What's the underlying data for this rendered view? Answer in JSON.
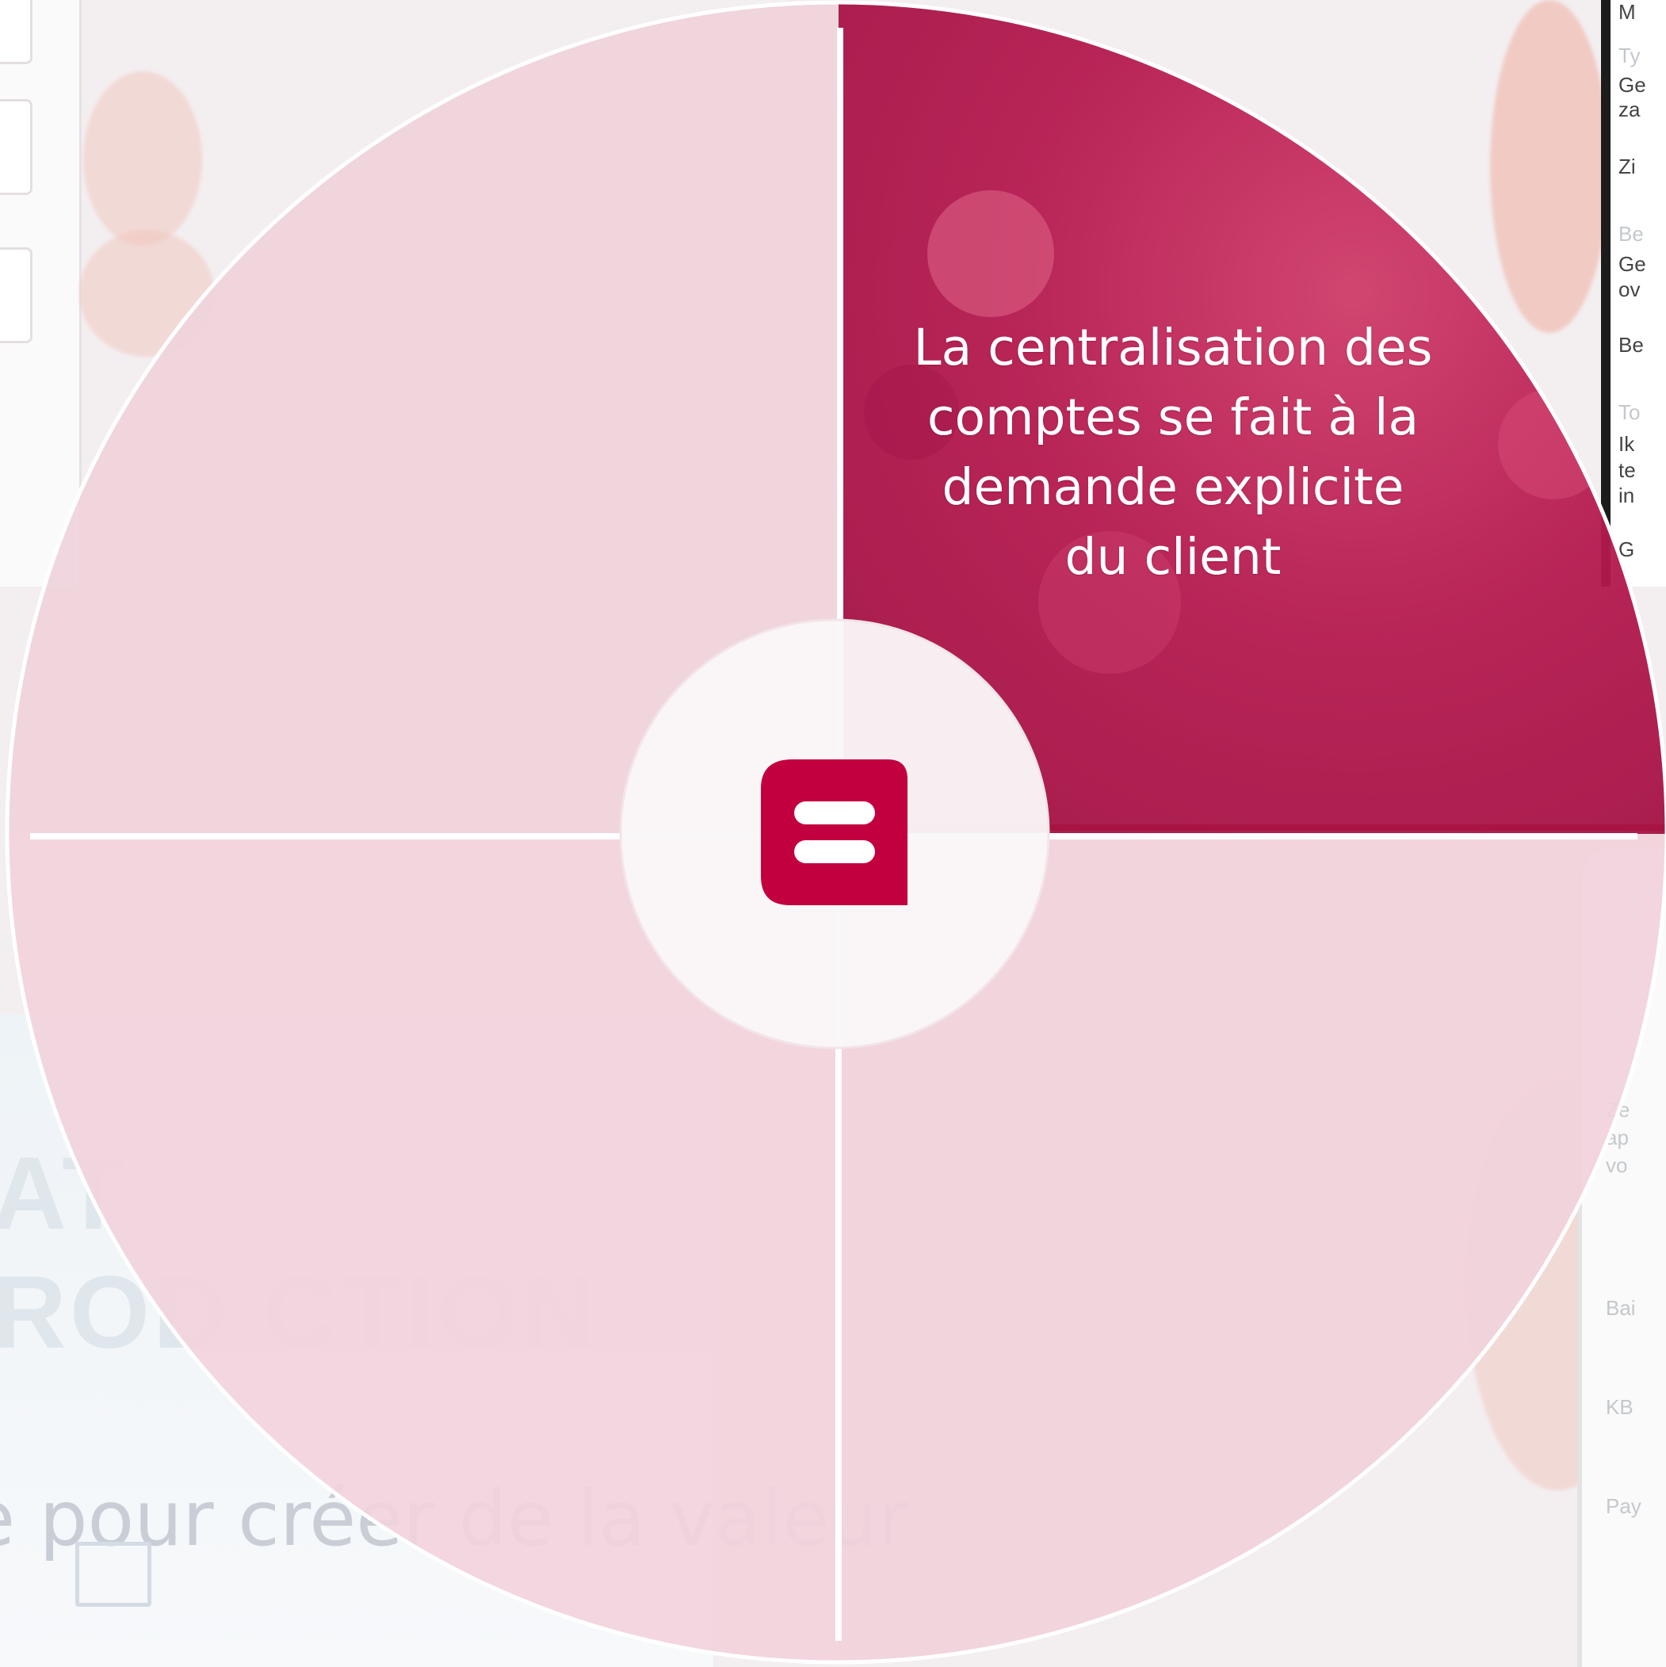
{
  "diagram": {
    "center_logo": "bank-logo-icon",
    "quadrants": [
      {
        "id": "top-left",
        "text": "",
        "active": false
      },
      {
        "id": "top-right",
        "text": "La centralisation des comptes se fait à la demande explicite du client",
        "active": true
      },
      {
        "id": "bottom-left",
        "text": "",
        "active": false
      },
      {
        "id": "bottom-right",
        "text": "",
        "active": false
      }
    ],
    "colors": {
      "active": "#b5174e",
      "inactive": "#f0d3dc",
      "center": "#faf7f8",
      "logo": "#c2003f",
      "ring": "#ffffff"
    }
  },
  "background": {
    "tagline": "e pour créer de la valeur"
  }
}
